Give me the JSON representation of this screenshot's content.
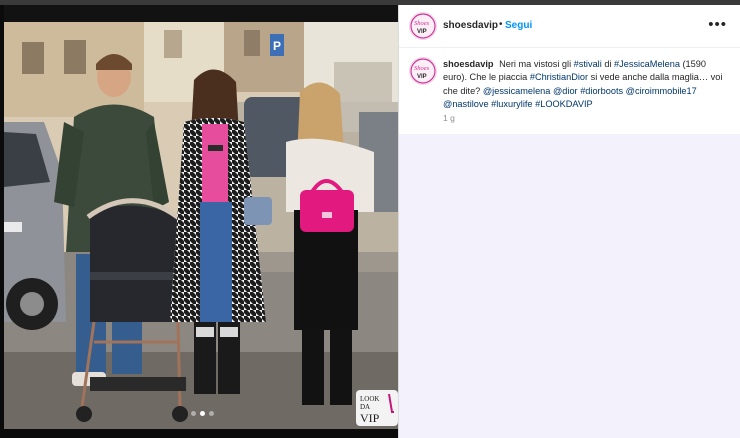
{
  "post": {
    "username": "shoesdavip",
    "separator": "•",
    "follow_label": "Segui",
    "more_icon": "more-horizontal-icon",
    "caption": {
      "t1": "Neri ma vistosi gli",
      "h1": "#stivali",
      "t2": "di",
      "h2": "#JessicaMelena",
      "t3": "(1590 euro). Che le piaccia",
      "h3": "#ChristianDior",
      "t4": "si vede anche dalla maglia… voi che dite?",
      "m1": "@jessicamelena",
      "m2": "@dior",
      "h4": "#diorboots",
      "m3": "@ciroimmobile17",
      "m4": "@nastilove",
      "h5": "#luxurylife",
      "h6": "#LOOKDAVIP"
    },
    "time_ago": "1 g"
  },
  "media": {
    "slides_total": 3,
    "active_slide": 2,
    "watermark": {
      "line1": "LOOK",
      "line2": "DA",
      "line3": "VIP"
    }
  },
  "logo": {
    "line1": "Shoes",
    "line2": "VIP"
  },
  "colors": {
    "accent_link": "#0095f6",
    "hashtag": "#00376b",
    "panel_bg": "#f3f1fb",
    "bag_pink": "#e2197f"
  }
}
